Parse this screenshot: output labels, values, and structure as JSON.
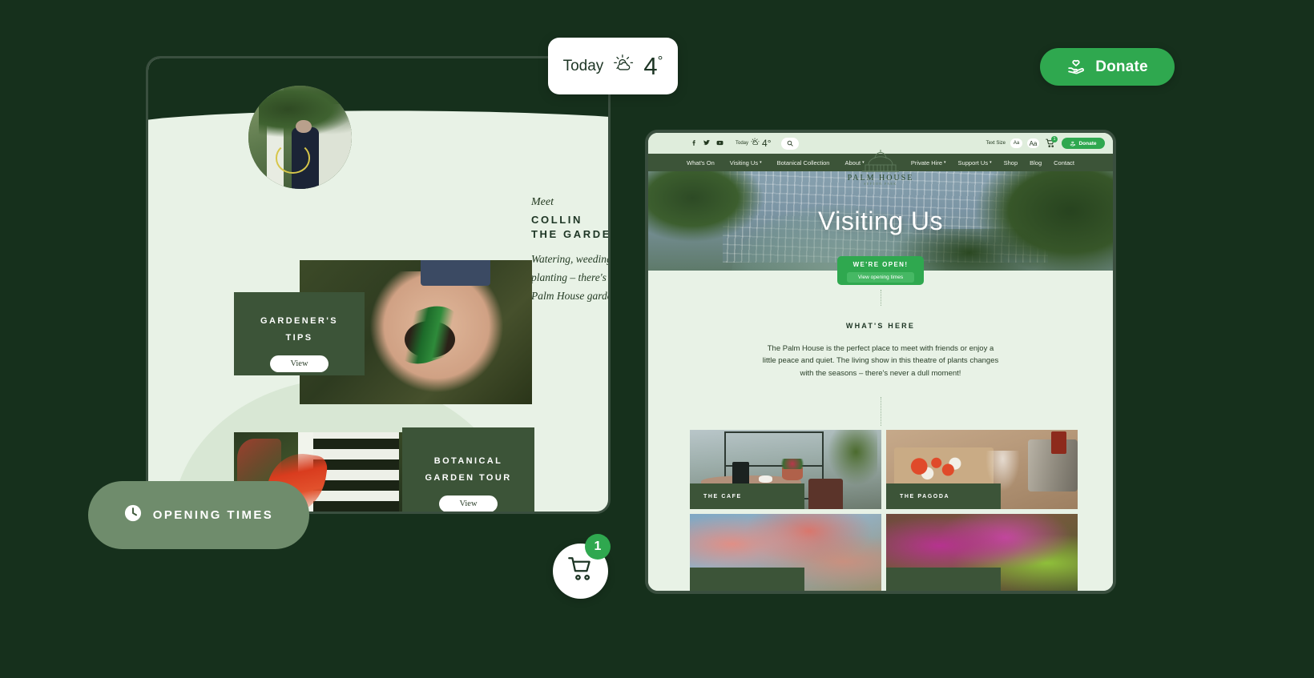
{
  "floating": {
    "donate_label": "Donate",
    "donate_icon": "hand-heart-icon",
    "opening_times_label": "OPENING TIMES",
    "clock_icon": "clock-icon",
    "cart_icon": "shopping-cart-icon",
    "cart_count": "1"
  },
  "weather_chip": {
    "today_label": "Today",
    "icon": "sun-cloud-icon",
    "temperature": "4",
    "degree": "°"
  },
  "tablet": {
    "meet_kicker": "Meet",
    "name_line1": "COLLIN",
    "name_line2": "THE GARDENER",
    "bio": "Watering, weeding, pruning and planting – there's no rest for the Palm House gardener!",
    "cards": [
      {
        "title_line1": "GARDENER'S",
        "title_line2": "TIPS",
        "button": "View"
      },
      {
        "title_line1": "BOTANICAL",
        "title_line2": "GARDEN TOUR",
        "button": "View"
      }
    ]
  },
  "site": {
    "utilbar": {
      "social": [
        "facebook-icon",
        "twitter-icon",
        "youtube-icon"
      ],
      "weather_label": "Today",
      "weather_temp": "4°",
      "search_icon": "search-icon",
      "text_size_label": "Text Size",
      "text_size_small": "Aa",
      "text_size_large": "Aa",
      "cart_icon": "shopping-cart-icon",
      "cart_count": "1",
      "donate_label": "Donate",
      "donate_icon": "hand-heart-icon"
    },
    "logo": {
      "name": "PALM HOUSE",
      "sub": "SEFTON PARK"
    },
    "nav_left": [
      {
        "label": "What's On",
        "caret": false
      },
      {
        "label": "Visiting Us",
        "caret": true
      },
      {
        "label": "Botanical Collection",
        "caret": false
      },
      {
        "label": "About",
        "caret": true
      }
    ],
    "nav_right": [
      {
        "label": "Private Hire",
        "caret": true
      },
      {
        "label": "Support Us",
        "caret": true
      },
      {
        "label": "Shop",
        "caret": false
      },
      {
        "label": "Blog",
        "caret": false
      },
      {
        "label": "Contact",
        "caret": false
      }
    ],
    "hero": {
      "title": "Visiting Us"
    },
    "open_button": {
      "headline": "WE'RE OPEN!",
      "sub_button": "View opening times"
    },
    "section": {
      "heading": "WHAT'S HERE",
      "body": "The Palm House is the perfect place to meet with friends or enjoy a little peace and quiet. The living show in this theatre of plants changes with the seasons – there's never a dull moment!"
    },
    "place_cards": [
      {
        "caption": "THE CAFE"
      },
      {
        "caption": "THE PAGODA"
      },
      {
        "caption": ""
      },
      {
        "caption": ""
      }
    ]
  },
  "colors": {
    "page_bg": "#16301c",
    "accent_green": "#2fa84f",
    "dark_green": "#3c5438",
    "pale_green": "#e8f2e6",
    "muted_green": "#6f8c6c"
  }
}
